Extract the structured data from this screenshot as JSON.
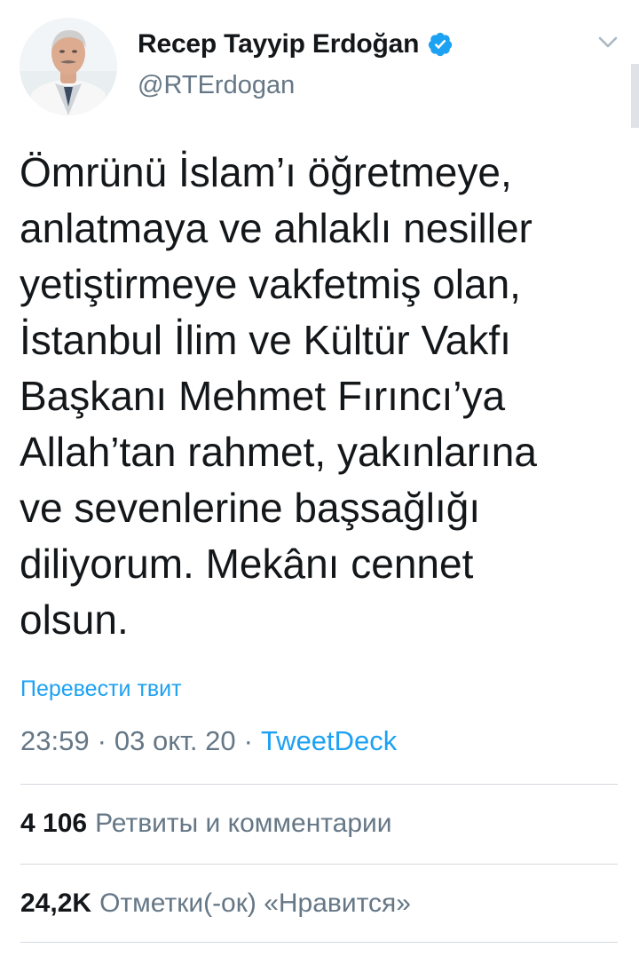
{
  "author": {
    "name": "Recep Tayyip Erdoğan",
    "handle": "@RTErdogan",
    "verified": true,
    "avatar_icon": "profile-photo"
  },
  "tweet": {
    "text": "Ömrünü İslam’ı öğretmeye,\nanlatmaya ve ahlaklı nesiller\nyetiştirmeye vakfetmiş olan,\nİstanbul İlim ve Kültür Vakfı\nBaşkanı Mehmet Fırıncı’ya\nAllah’tan rahmet, yakınlarına\nve sevenlerine başsağlığı\ndiliyorum. Mekânı cennet\nolsun.",
    "translate_label": "Перевести твит",
    "time": "23:59",
    "date": "03 окт. 20",
    "separator": "·",
    "source": "TweetDeck"
  },
  "stats": {
    "retweets_count": "4 106",
    "retweets_label": "Ретвиты и комментарии",
    "likes_count": "24,2K",
    "likes_label": "Отметки(-ок) «Нравится»"
  },
  "colors": {
    "link": "#1da1f2",
    "secondary_text": "#657786",
    "primary_text": "#14171a",
    "divider": "#d3d9de"
  },
  "icons": {
    "verified": "verified-badge-icon",
    "menu": "chevron-down-icon"
  }
}
